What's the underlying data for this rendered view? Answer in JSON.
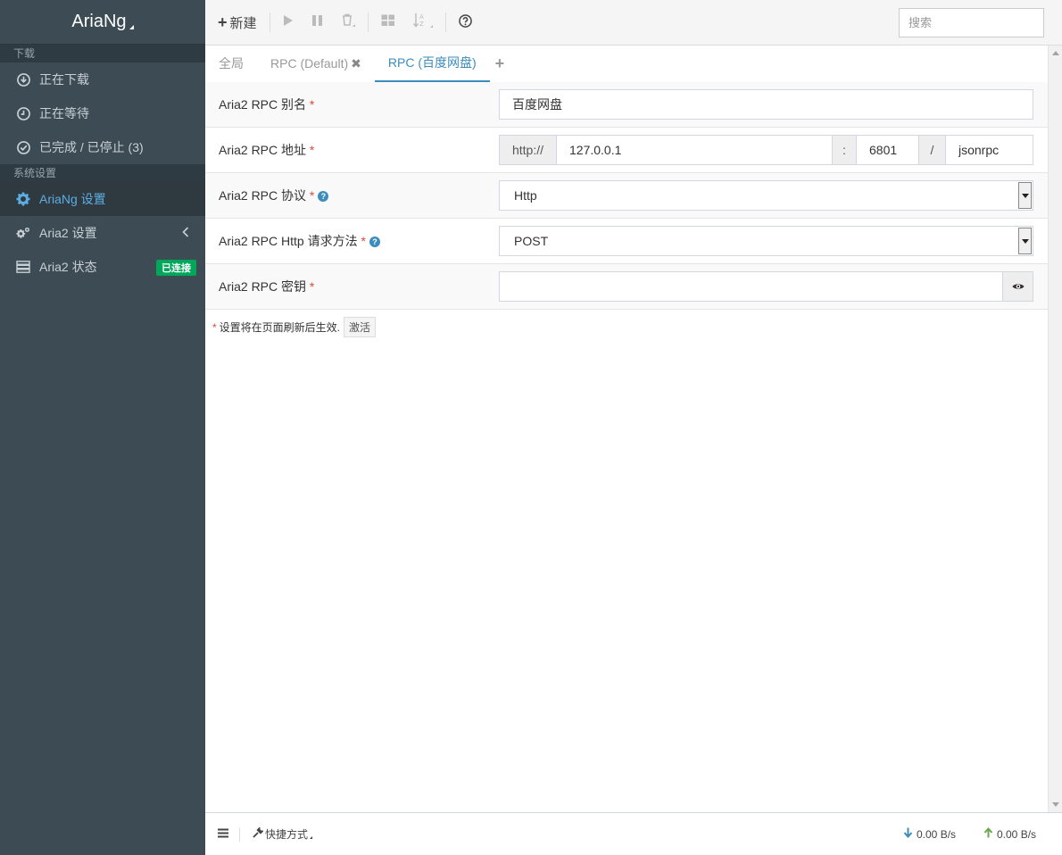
{
  "app": {
    "title": "AriaNg"
  },
  "sidebar": {
    "sections": [
      {
        "header": "下载",
        "items": [
          {
            "label": "正在下载",
            "icon": "download-circle-icon"
          },
          {
            "label": "正在等待",
            "icon": "clock-icon"
          },
          {
            "label": "已完成 / 已停止 (3)",
            "icon": "check-circle-icon"
          }
        ]
      },
      {
        "header": "系统设置",
        "items": [
          {
            "label": "AriaNg 设置",
            "icon": "gear-icon",
            "active": true
          },
          {
            "label": "Aria2 设置",
            "icon": "gears-icon"
          },
          {
            "label": "Aria2 状态",
            "icon": "server-icon",
            "badge": "已连接"
          }
        ]
      }
    ]
  },
  "toolbar": {
    "new_label": "新建",
    "search_placeholder": "搜索"
  },
  "tabs": [
    {
      "label": "全局"
    },
    {
      "label": "RPC (Default)"
    },
    {
      "label": "RPC (百度网盘)",
      "active": true
    }
  ],
  "form": {
    "alias": {
      "label": "Aria2 RPC 别名",
      "value": "百度网盘"
    },
    "address": {
      "label": "Aria2 RPC 地址",
      "protocol_prefix": "http://",
      "host": "127.0.0.1",
      "colon": ":",
      "port": "6801",
      "slash": "/",
      "path": "jsonrpc"
    },
    "protocol": {
      "label": "Aria2 RPC 协议",
      "value": "Http"
    },
    "method": {
      "label": "Aria2 RPC Http 请求方法",
      "value": "POST"
    },
    "secret": {
      "label": "Aria2 RPC 密钥",
      "value": ""
    },
    "required_mark": "*"
  },
  "note": {
    "text": "设置将在页面刷新后生效.",
    "activate_label": "激活"
  },
  "footer": {
    "shortcuts_label": "快捷方式",
    "download_speed": "0.00 B/s",
    "upload_speed": "0.00 B/s"
  },
  "colors": {
    "sidebar_bg": "#3c4b54",
    "accent": "#3c8dbc",
    "badge": "#00a65a",
    "required": "#dd4b39"
  }
}
